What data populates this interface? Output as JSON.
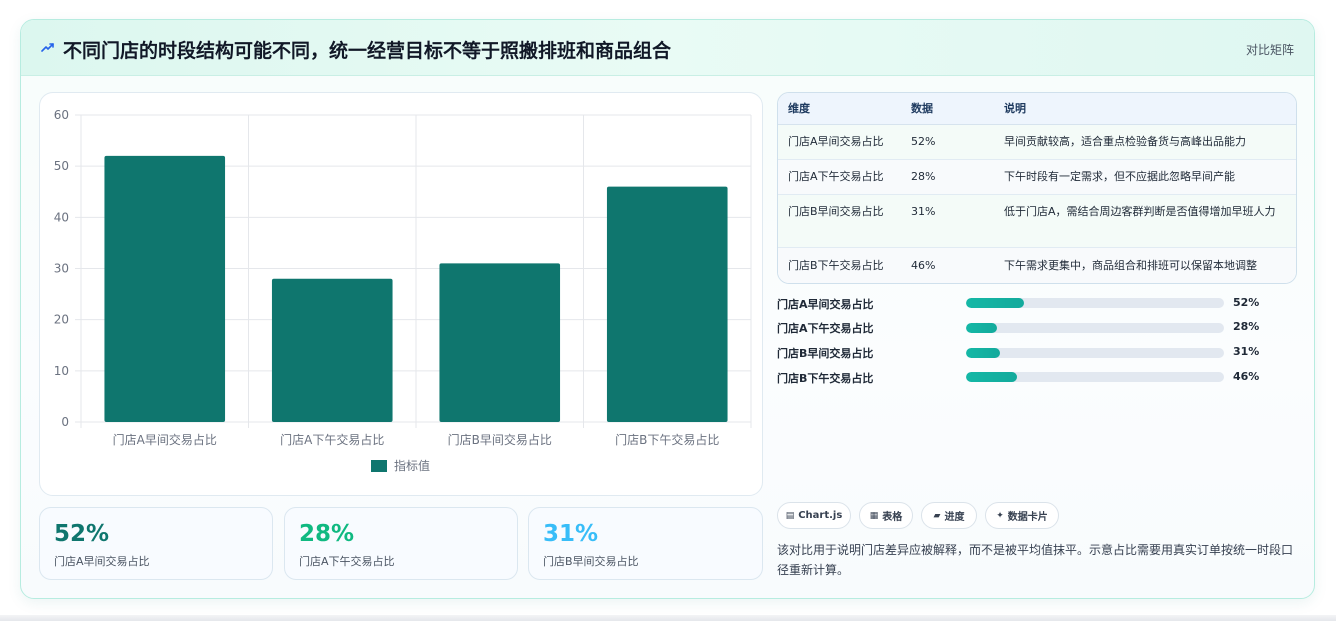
{
  "header": {
    "title": "不同门店的时段结构可能不同，统一经营目标不等于照搬排班和商品组合",
    "tag": "对比矩阵"
  },
  "chart_data": {
    "type": "bar",
    "categories": [
      "门店A早间交易占比",
      "门店A下午交易占比",
      "门店B早间交易占比",
      "门店B下午交易占比"
    ],
    "series": [
      {
        "name": "指标值",
        "values": [
          52,
          28,
          31,
          46
        ]
      }
    ],
    "ylim": [
      0,
      60
    ],
    "yticks": [
      0,
      10,
      20,
      30,
      40,
      50,
      60
    ],
    "grid": true,
    "legend": "bottom",
    "colors": {
      "bar": "#0f766e",
      "grid": "#e5e7eb",
      "axis_text": "#6b7280"
    }
  },
  "stats": [
    {
      "value": "52%",
      "label": "门店A早间交易占比",
      "color": "#0f766e"
    },
    {
      "value": "28%",
      "label": "门店A下午交易占比",
      "color": "#10b981"
    },
    {
      "value": "31%",
      "label": "门店B早间交易占比",
      "color": "#38bdf8"
    }
  ],
  "table": {
    "headers": [
      "维度",
      "数据",
      "说明"
    ],
    "rows": [
      [
        "门店A早间交易占比",
        "52%",
        "早间贡献较高，适合重点检验备货与高峰出品能力"
      ],
      [
        "门店A下午交易占比",
        "28%",
        "下午时段有一定需求，但不应据此忽略早间产能"
      ],
      [
        "门店B早间交易占比",
        "31%",
        "低于门店A，需结合周边客群判断是否值得增加早班人力"
      ],
      [
        "门店B下午交易占比",
        "46%",
        "下午需求更集中，商品组合和排班可以保留本地调整"
      ]
    ]
  },
  "progress": [
    {
      "label": "门店A早间交易占比",
      "value": 52,
      "text": "52%"
    },
    {
      "label": "门店A下午交易占比",
      "value": 28,
      "text": "28%"
    },
    {
      "label": "门店B早间交易占比",
      "value": 31,
      "text": "31%"
    },
    {
      "label": "门店B下午交易占比",
      "value": 46,
      "text": "46%"
    }
  ],
  "chips": [
    {
      "icon": "▤",
      "label": "Chart.js"
    },
    {
      "icon": "▦",
      "label": "表格"
    },
    {
      "icon": "▰",
      "label": "进度"
    },
    {
      "icon": "✦",
      "label": "数据卡片"
    }
  ],
  "note": "该对比用于说明门店差异应被解释，而不是被平均值抹平。示意占比需要用真实订单按统一时段口径重新计算。",
  "colors": {
    "accent": "#0f766e",
    "progress": "#14b8a6",
    "header_bg": "#dcf7ef"
  }
}
